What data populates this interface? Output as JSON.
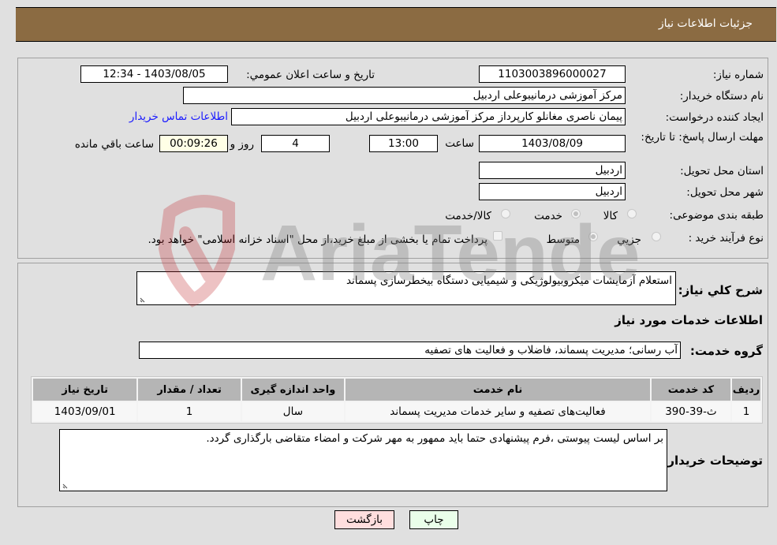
{
  "header": {
    "title": "جزئیات اطلاعات نیاز"
  },
  "fields": {
    "need_number": {
      "label": "شماره نیاز:",
      "value": "1103003896000027"
    },
    "announce_datetime": {
      "label": "تاریخ و ساعت اعلان عمومي:",
      "value": "1403/08/05 - 12:34"
    },
    "buyer_org": {
      "label": "نام دستگاه خریدار:",
      "value": "مرکز آموزشی درمانیبوعلی اردبیل"
    },
    "requester": {
      "label": "ایجاد کننده درخواست:",
      "value": "پیمان ناصری مغانلو کارپرداز مرکز آموزشی درمانیبوعلی اردبیل"
    },
    "buyer_contact_link": "اطلاعات تماس خریدار",
    "deadline": {
      "label": "مهلت ارسال پاسخ: تا تاریخ:",
      "date": "1403/08/09",
      "time_label": "ساعت",
      "time": "13:00",
      "days": "4",
      "days_label": "روز و",
      "remaining": "00:09:26",
      "remaining_label": "ساعت باقي مانده"
    },
    "province": {
      "label": "استان محل تحویل:",
      "value": "اردبیل"
    },
    "city": {
      "label": "شهر محل تحویل:",
      "value": "اردبیل"
    },
    "category": {
      "label": "طبقه بندی موضوعی:",
      "options": [
        "کالا",
        "خدمت",
        "کالا/خدمت"
      ],
      "selected": "خدمت"
    },
    "purchase_type": {
      "label": "نوع فرآیند خرید :",
      "options": [
        "جزيي",
        "متوسط"
      ],
      "selected": "متوسط",
      "treasury_checkbox_label": "پرداخت تمام یا بخشی از مبلغ خرید،از محل \"اسناد خزانه اسلامی\" خواهد بود.",
      "treasury_checked": false
    }
  },
  "description": {
    "label": "شرح کلي نیاز:",
    "value": "استعلام آزمایشات میکروبیولوژیکی و شیمیایی دستگاه بیخطرسازی پسماند"
  },
  "services_section_title": "اطلاعات خدمات مورد نیاز",
  "service_group": {
    "label": "گروه خدمت:",
    "value": "آب رسانی؛ مدیریت پسماند، فاضلاب و فعالیت های تصفیه"
  },
  "table": {
    "columns": [
      "ردیف",
      "کد خدمت",
      "نام خدمت",
      "واحد اندازه گیری",
      "تعداد / مقدار",
      "تاریخ نیاز"
    ],
    "rows": [
      [
        "1",
        "ث-39-390",
        "فعالیت‌های تصفیه و سایر خدمات مدیریت پسماند",
        "سال",
        "1",
        "1403/09/01"
      ]
    ]
  },
  "buyer_notes": {
    "label": "توضیحات خریدار:",
    "value": "بر اساس لیست پیوستی ،فرم پیشنهادی حتما باید ممهور به مهر شرکت و امضاء متقاضی بارگذاری گردد."
  },
  "buttons": {
    "print": "چاپ",
    "back": "بازگشت"
  },
  "colors": {
    "header_bg": "#8b6b42",
    "link": "#1a1aff",
    "print_bg": "#eaffea",
    "back_bg": "#ffdede"
  },
  "watermark": "AriaTender.neT"
}
